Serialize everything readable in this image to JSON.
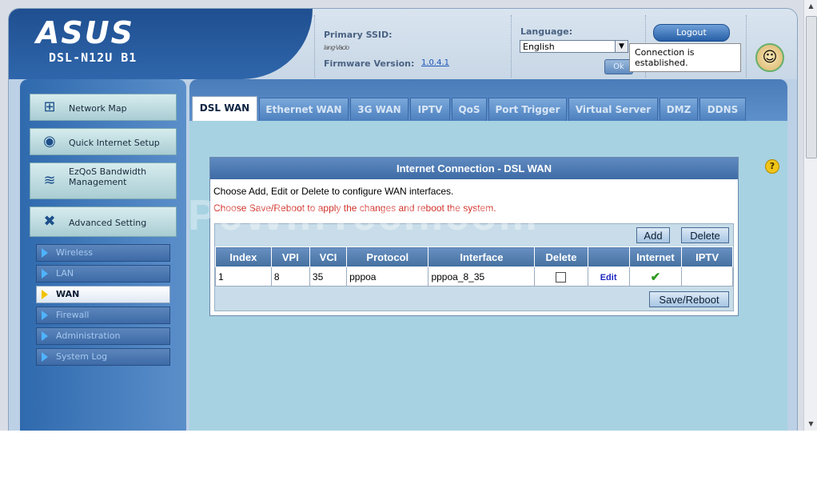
{
  "header": {
    "brand": "ASUS",
    "model": "DSL-N12U B1",
    "ssid_label": "Primary SSID:",
    "ssid_value": "lang·Vacio",
    "firmware_label": "Firmware Version:",
    "firmware_value": "1.0.4.1",
    "language_label": "Language:",
    "language_value": "English",
    "ok_label": "Ok",
    "logout_label": "Logout",
    "tooltip": "Connection is established."
  },
  "sidebar": {
    "items": [
      {
        "label": "Network Map",
        "icon": "network-map-icon"
      },
      {
        "label": "Quick Internet Setup",
        "icon": "router-icon"
      },
      {
        "label": "EzQoS Bandwidth Management",
        "icon": "qos-icon"
      },
      {
        "label": "Advanced Setting",
        "icon": "wrench-icon"
      }
    ],
    "sub_items": [
      {
        "label": "Wireless"
      },
      {
        "label": "LAN"
      },
      {
        "label": "WAN"
      },
      {
        "label": "Firewall"
      },
      {
        "label": "Administration"
      },
      {
        "label": "System Log"
      }
    ],
    "active_sub": "WAN"
  },
  "tabs": [
    "DSL WAN",
    "Ethernet WAN",
    "3G WAN",
    "IPTV",
    "QoS",
    "Port Trigger",
    "Virtual Server",
    "DMZ",
    "DDNS"
  ],
  "active_tab": "DSL WAN",
  "panel": {
    "title": "Internet Connection - DSL WAN",
    "desc1": "Choose Add, Edit or Delete to configure WAN interfaces.",
    "desc2": "Choose Save/Reboot to apply the changes and reboot the system.",
    "add_label": "Add",
    "delete_label": "Delete",
    "save_label": "Save/Reboot",
    "columns": [
      "Index",
      "VPI",
      "VCI",
      "Protocol",
      "Interface",
      "Delete",
      "",
      "Internet",
      "IPTV"
    ],
    "rows": [
      {
        "index": "1",
        "vpi": "8",
        "vci": "35",
        "protocol": "pppoa",
        "interface": "pppoa_8_35",
        "edit": "Edit",
        "internet": "✔",
        "iptv": ""
      }
    ]
  },
  "watermark": "PcWinTech.com",
  "colors": {
    "accent": "#2f66ab",
    "tab_active": "#ffffff",
    "warning_text": "#d1312a",
    "link": "#1c27c2"
  }
}
